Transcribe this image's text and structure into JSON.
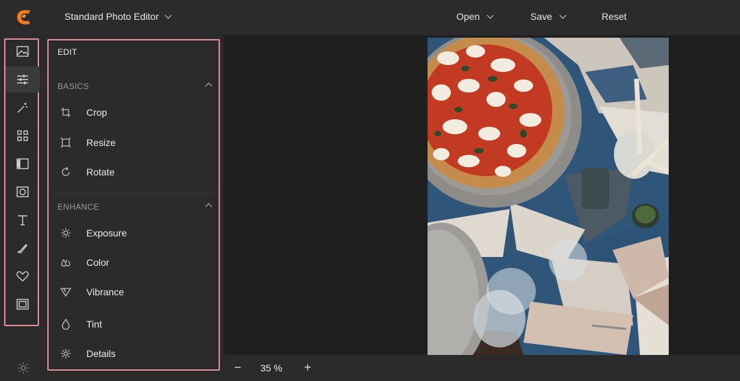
{
  "app": {
    "title": "Standard Photo Editor",
    "brand_color": "#f07a22"
  },
  "topbar": {
    "open_label": "Open",
    "save_label": "Save",
    "reset_label": "Reset"
  },
  "rail": {
    "items": [
      {
        "name": "image-icon"
      },
      {
        "name": "adjust-sliders-icon",
        "active": true
      },
      {
        "name": "magic-wand-icon"
      },
      {
        "name": "grid-icon"
      },
      {
        "name": "filmstrip-icon"
      },
      {
        "name": "frame-circle-icon"
      },
      {
        "name": "text-icon"
      },
      {
        "name": "brush-icon"
      },
      {
        "name": "heart-icon"
      },
      {
        "name": "border-frame-icon"
      }
    ],
    "settings_icon": "gear-icon"
  },
  "panel": {
    "title": "EDIT",
    "sections": [
      {
        "header": "BASICS",
        "tools": [
          {
            "label": "Crop",
            "icon": "crop-icon"
          },
          {
            "label": "Resize",
            "icon": "resize-icon"
          },
          {
            "label": "Rotate",
            "icon": "rotate-icon"
          }
        ]
      },
      {
        "header": "ENHANCE",
        "tools": [
          {
            "label": "Exposure",
            "icon": "sun-icon"
          },
          {
            "label": "Color",
            "icon": "drops-icon"
          },
          {
            "label": "Vibrance",
            "icon": "triangle-icon"
          },
          {
            "label": "Tint",
            "icon": "drop-icon"
          },
          {
            "label": "Details",
            "icon": "sparkle-icon"
          }
        ]
      }
    ],
    "highlight_color": "#e48d9a"
  },
  "zoom": {
    "value": "35 %",
    "minus": "−",
    "plus": "+"
  },
  "canvas": {
    "image": "pizza-photo"
  }
}
